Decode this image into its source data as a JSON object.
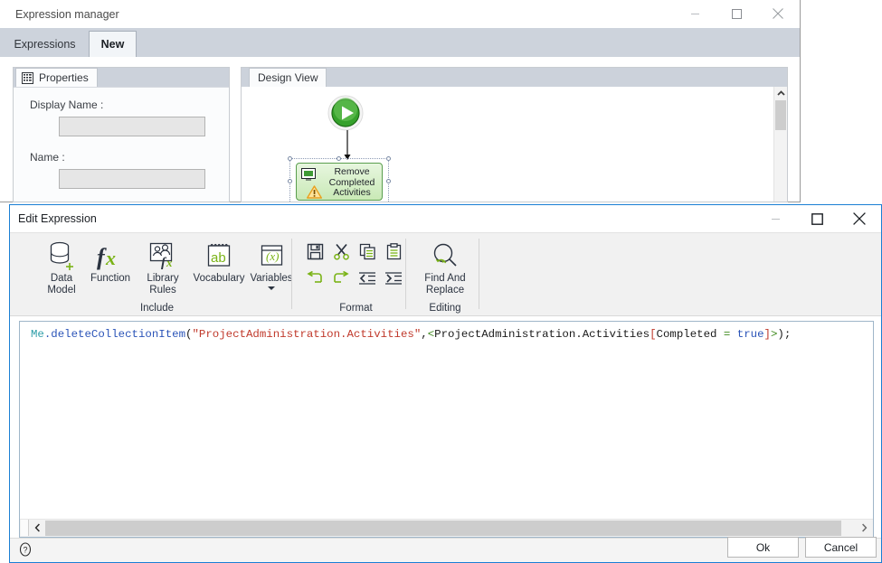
{
  "background_window": {
    "title": "Expression manager",
    "controls": {
      "minimize": "minimize-icon",
      "maximize": "maximize-icon",
      "close": "close-icon"
    },
    "tabs": [
      {
        "label": "Expressions",
        "active": false
      },
      {
        "label": "New",
        "active": true
      }
    ],
    "properties_panel": {
      "tab_label": "Properties",
      "tab_icon": "properties-grid-icon",
      "fields": [
        {
          "label": "Display Name :",
          "value": "",
          "placeholder": ""
        },
        {
          "label": "Name :",
          "value": "",
          "placeholder": ""
        }
      ]
    },
    "design_panel": {
      "tab_label": "Design View",
      "start_node_icon": "play-start-icon",
      "activity": {
        "label": "Remove\nCompleted\nActivities",
        "icon": "activity-screen-icon",
        "warning_icon": "warning-triangle-icon",
        "selected": true
      },
      "scrollbar": {
        "name": "design-view-vertical-scrollbar"
      }
    }
  },
  "dialog": {
    "title": "Edit Expression",
    "controls": {
      "minimize": "minimize-icon",
      "maximize": "maximize-icon",
      "close": "close-icon"
    },
    "ribbon": {
      "groups": [
        {
          "title": "Include",
          "buttons": [
            {
              "label": "Data\nModel",
              "icon": "database-add-icon",
              "has_caret": false
            },
            {
              "label": "Function",
              "icon": "fx-function-icon",
              "has_caret": false
            },
            {
              "label": "Library\nRules",
              "icon": "library-rules-icon",
              "has_caret": false
            },
            {
              "label": "Vocabulary",
              "icon": "vocabulary-ab-icon",
              "has_caret": false
            },
            {
              "label": "Variables",
              "icon": "variables-x-icon",
              "has_caret": true
            }
          ]
        },
        {
          "title": "Format",
          "buttons": [
            {
              "label": "Save",
              "icon": "save-floppy-icon"
            },
            {
              "label": "Cut",
              "icon": "scissors-cut-icon"
            },
            {
              "label": "Copy",
              "icon": "copy-icon"
            },
            {
              "label": "Paste",
              "icon": "paste-clipboard-icon"
            },
            {
              "label": "Undo",
              "icon": "undo-arrow-icon"
            },
            {
              "label": "Redo",
              "icon": "redo-arrow-icon"
            },
            {
              "label": "Decrease Indent",
              "icon": "outdent-icon"
            },
            {
              "label": "Increase Indent",
              "icon": "indent-icon"
            }
          ]
        },
        {
          "title": "Editing",
          "buttons": [
            {
              "label": "Find And\nReplace",
              "icon": "find-replace-magnifier-icon",
              "has_caret": false
            }
          ]
        }
      ]
    },
    "editor": {
      "expression_text": "Me.deleteCollectionItem(\"ProjectAdministration.Activities\",<ProjectAdministration.Activities[Completed = true]>);",
      "tokens": [
        {
          "text": "Me",
          "kind": "me"
        },
        {
          "text": ".deleteCollectionItem",
          "kind": "member"
        },
        {
          "text": "(",
          "kind": "punct"
        },
        {
          "text": "\"ProjectAdministration.Activities\"",
          "kind": "string"
        },
        {
          "text": ",",
          "kind": "punct"
        },
        {
          "text": "<",
          "kind": "op"
        },
        {
          "text": "ProjectAdministration.Activities",
          "kind": "plain"
        },
        {
          "text": "[",
          "kind": "bracket"
        },
        {
          "text": "Completed ",
          "kind": "plain"
        },
        {
          "text": "=",
          "kind": "op"
        },
        {
          "text": " ",
          "kind": "plain"
        },
        {
          "text": "true",
          "kind": "kw"
        },
        {
          "text": "]",
          "kind": "bracket"
        },
        {
          "text": ">",
          "kind": "op"
        },
        {
          "text": ");",
          "kind": "punct"
        }
      ],
      "hscrollbar": {
        "name": "editor-horizontal-scrollbar"
      }
    },
    "footer": {
      "help_icon": "help-question-icon",
      "ok_label": "Ok",
      "cancel_label": "Cancel"
    }
  },
  "colors": {
    "dialog_border": "#1a7fd4",
    "tabstrip": "#cdd3dc",
    "ribbon_bg": "#f1f1f1",
    "icon_dark": "#2b3340",
    "icon_green": "#7ab317",
    "string_red": "#c0392b",
    "keyword_blue": "#2b54b8",
    "activity_green": "#5a9e4e"
  }
}
